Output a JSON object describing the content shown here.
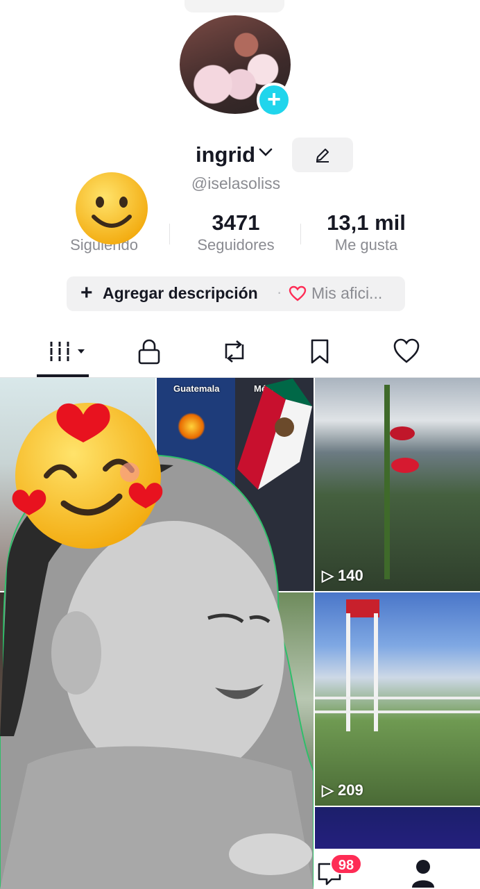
{
  "profile": {
    "display_name": "ingrid",
    "handle": "@iselasoliss"
  },
  "stats": [
    {
      "value": "",
      "label": "Siguiendo"
    },
    {
      "value": "3471",
      "label": "Seguidores"
    },
    {
      "value": "13,1 mil",
      "label": "Me gusta"
    }
  ],
  "description": {
    "add_label": "Agregar descripción",
    "separator": "·",
    "hobbies_label": "Mis afici..."
  },
  "tabs": [
    {
      "icon": "grid-icon",
      "active": true
    },
    {
      "icon": "lock-icon",
      "active": false
    },
    {
      "icon": "repost-icon",
      "active": false
    },
    {
      "icon": "bookmark-icon",
      "active": false
    },
    {
      "icon": "heart-icon",
      "active": false
    }
  ],
  "videos": [
    {
      "caption": "",
      "views": ""
    },
    {
      "caption_left": "Guatemala",
      "caption_right": "México",
      "views": ""
    },
    {
      "caption": "",
      "views": "140"
    },
    {
      "caption": "",
      "views": ""
    },
    {
      "caption": "",
      "views": ""
    },
    {
      "caption": "",
      "views": "209"
    }
  ],
  "nav": {
    "inbox_badge": "98"
  },
  "colors": {
    "accent": "#20d5ec",
    "badge": "#fe2c55",
    "text": "#161823",
    "muted": "#8a8b91"
  }
}
